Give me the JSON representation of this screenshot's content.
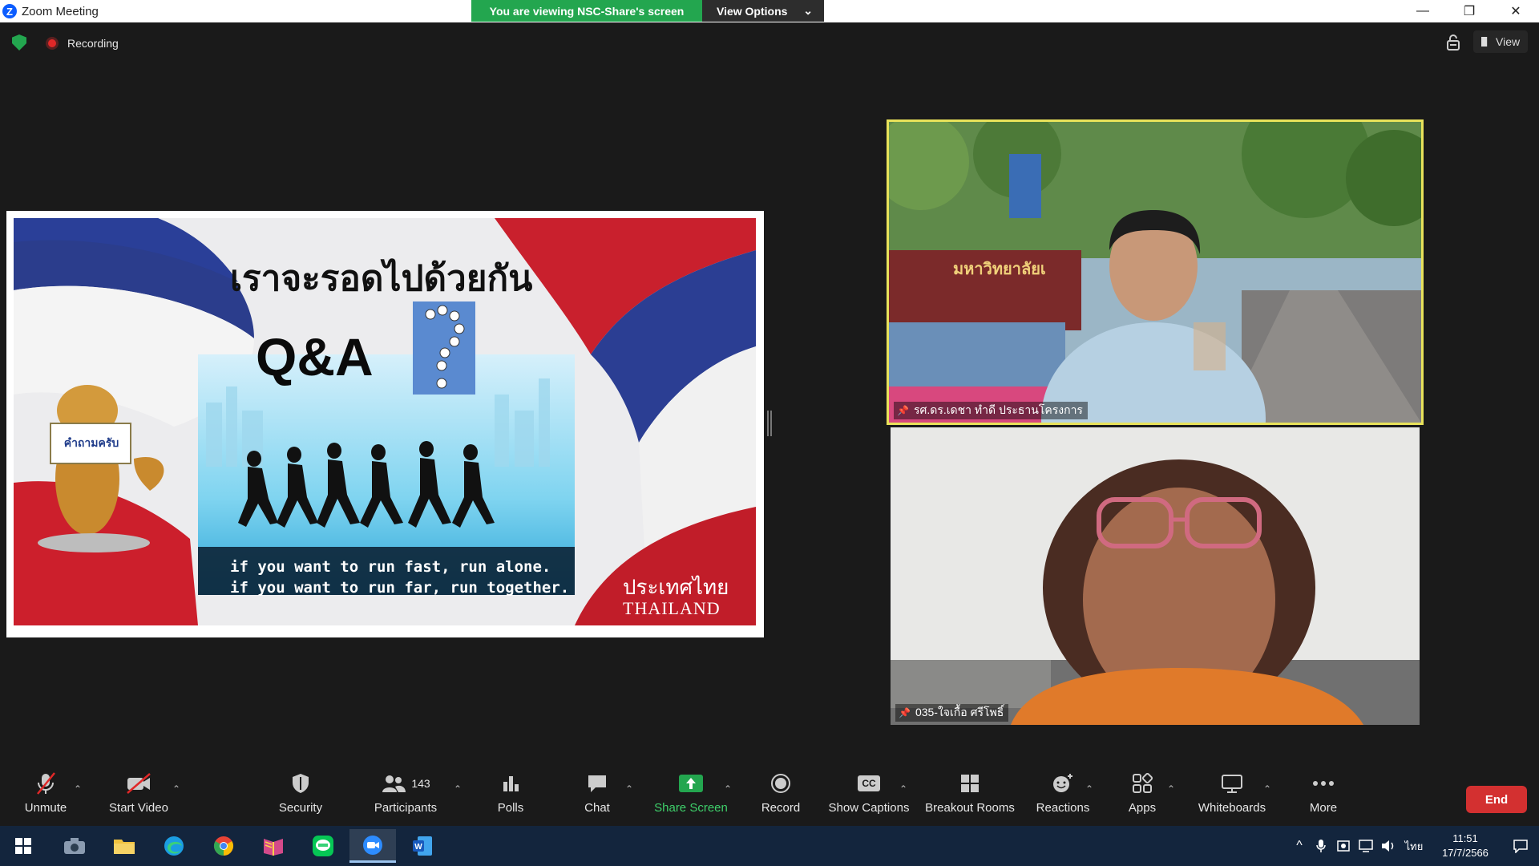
{
  "window": {
    "title": "Zoom Meeting",
    "minimize": "—",
    "restore": "❐",
    "close": "✕"
  },
  "banner": {
    "viewing": "You are viewing NSC-Share's screen",
    "view_options": "View Options",
    "chevron": "⌄"
  },
  "status": {
    "recording": "Recording",
    "view": "View"
  },
  "slide": {
    "thai_title": "เราจะรอดไปด้วยกัน",
    "qa": "Q&A",
    "sign": "คำถามครับ",
    "quote1": "if you want to run fast, run alone.",
    "quote2": "if you want to run far, run together.",
    "country_thai": "ประเทศไทย",
    "country_en": "THAILAND"
  },
  "participants": [
    {
      "name": "รศ.ดร.เดชา ทำดี ประธานโครงการ",
      "sign_text": "มหาวิทยาลัยเ"
    },
    {
      "name": "035-ใจเกื้อ ศรีโพธิ์"
    }
  ],
  "toolbar": {
    "unmute": "Unmute",
    "start_video": "Start Video",
    "security": "Security",
    "participants": "Participants",
    "participants_count": "143",
    "polls": "Polls",
    "chat": "Chat",
    "share_screen": "Share Screen",
    "record": "Record",
    "show_captions": "Show Captions",
    "breakout_rooms": "Breakout Rooms",
    "reactions": "Reactions",
    "apps": "Apps",
    "whiteboards": "Whiteboards",
    "more": "More",
    "end": "End",
    "cc": "CC",
    "caret": "⌃"
  },
  "taskbar": {
    "lang": "ไทย",
    "time": "11:51",
    "date": "17/7/2566",
    "chevron_up": "^"
  },
  "colors": {
    "accent_green": "#23a64f",
    "end_red": "#d33030",
    "speaker_border": "#e8e25a",
    "taskbar_bg": "#13253d"
  }
}
